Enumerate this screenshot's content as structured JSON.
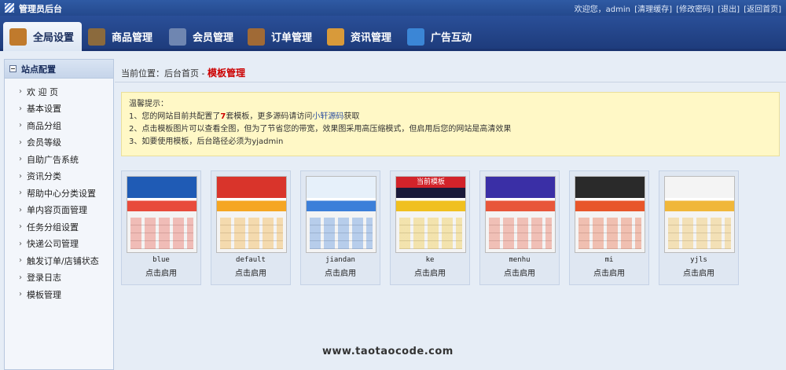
{
  "app": {
    "title": "管理员后台"
  },
  "topbar": {
    "welcome": "欢迎您，admin",
    "links": [
      "[清理缓存]",
      "[修改密码]",
      "[退出]",
      "[返回首页]"
    ]
  },
  "nav": {
    "tabs": [
      {
        "label": "全局设置",
        "icon": "settings-icon",
        "color": "#c07a2c",
        "active": true
      },
      {
        "label": "商品管理",
        "icon": "goods-icon",
        "color": "#8b6a3d"
      },
      {
        "label": "会员管理",
        "icon": "members-icon",
        "color": "#6f86b1"
      },
      {
        "label": "订单管理",
        "icon": "orders-icon",
        "color": "#a06a36"
      },
      {
        "label": "资讯管理",
        "icon": "news-icon",
        "color": "#d89a3a"
      },
      {
        "label": "广告互动",
        "icon": "ads-icon",
        "color": "#3b86d6"
      }
    ]
  },
  "sidebar": {
    "section": "站点配置",
    "items": [
      "欢 迎 页",
      "基本设置",
      "商品分组",
      "会员等级",
      "自助广告系统",
      "资讯分类",
      "帮助中心分类设置",
      "单内容页面管理",
      "任务分组设置",
      "快递公司管理",
      "触发订单/店铺状态",
      "登录日志",
      "模板管理"
    ]
  },
  "breadcrumb": {
    "prefix": "当前位置：后台首页 -",
    "current": "模板管理"
  },
  "tips": {
    "title": "温馨提示：",
    "line1_a": "1、您的网站目前共配置了",
    "line1_n": "7",
    "line1_b": "套模板，更多源码请访问",
    "line1_link": "小轩源码",
    "line1_c": "获取",
    "line2": "2、点击模板图片可以查看全图，但为了节省您的带宽，效果图采用高压缩模式，但启用后您的网站是高清效果",
    "line3": "3、如要使用模板，后台路径必须为yjadmin"
  },
  "templates": [
    {
      "name": "blue",
      "action": "点击启用",
      "c1": "#1f5bb5",
      "c2": "#e84b3c"
    },
    {
      "name": "default",
      "action": "点击启用",
      "c1": "#d9342b",
      "c2": "#f5a623"
    },
    {
      "name": "jiandan",
      "action": "点击启用",
      "c1": "#e6f0fa",
      "c2": "#3c7fd9"
    },
    {
      "name": "ke",
      "action": "点击启用",
      "c1": "#1a1a3a",
      "c2": "#f0c020",
      "badge": "当前模板"
    },
    {
      "name": "menhu",
      "action": "点击启用",
      "c1": "#3a2fa6",
      "c2": "#e8563a"
    },
    {
      "name": "mi",
      "action": "点击启用",
      "c1": "#2a2a2a",
      "c2": "#e8562a"
    },
    {
      "name": "yjls",
      "action": "点击启用",
      "c1": "#f4f4f4",
      "c2": "#f0b73a"
    }
  ],
  "watermark": {
    "text": "www.taotaocode.com"
  }
}
